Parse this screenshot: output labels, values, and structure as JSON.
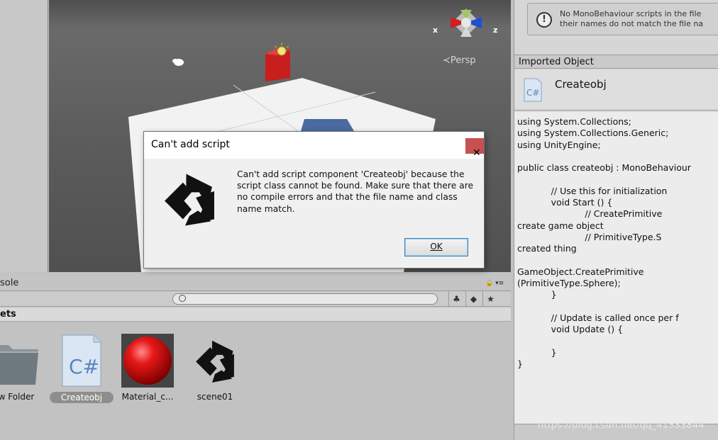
{
  "scene": {
    "persp_label": "≺Persp",
    "gizmo_x": "x",
    "gizmo_z": "z"
  },
  "console_panel": {
    "tab_label": "sole",
    "assets_header": "ets"
  },
  "assets": [
    {
      "label": "w Folder",
      "icon": "folder-icon",
      "selected": false
    },
    {
      "label": "Createobj",
      "icon": "csharp-script-icon",
      "selected": true
    },
    {
      "label": "Material_c...",
      "icon": "material-sphere-icon",
      "selected": false
    },
    {
      "label": "scene01",
      "icon": "unity-scene-icon",
      "selected": false
    }
  ],
  "inspector": {
    "help_text_line1": "No MonoBehaviour scripts in the file",
    "help_text_line2": "their names do not match the file na",
    "imported_header": "Imported Object",
    "object_name": "Createobj",
    "code": "using System.Collections;\nusing System.Collections.Generic;\nusing UnityEngine;\n\npublic class createobj : MonoBehaviour\n\n            // Use this for initialization\n            void Start () {\n                        // CreatePrimitive\ncreate game object\n                        // PrimitiveType.S\ncreated thing\n\nGameObject.CreatePrimitive\n(PrimitiveType.Sphere);\n            }\n\n            // Update is called once per f\n            void Update () {\n\n            }\n}"
  },
  "dialog": {
    "title": "Can't add script",
    "close_glyph": "✕",
    "message": "Can't add script component 'Createobj' because the script class cannot be found. Make sure that there are no compile errors and that the file name and class name match.",
    "ok_label": "OK"
  },
  "watermark": "https://blog.csdn.net/qq_41333844",
  "colors": {
    "close_button": "#c75050",
    "cube_red": "#c81e1e",
    "gizmo_x_red": "#d02020",
    "gizmo_z_blue": "#2050d0",
    "selection_grey": "#8e8e8e"
  }
}
